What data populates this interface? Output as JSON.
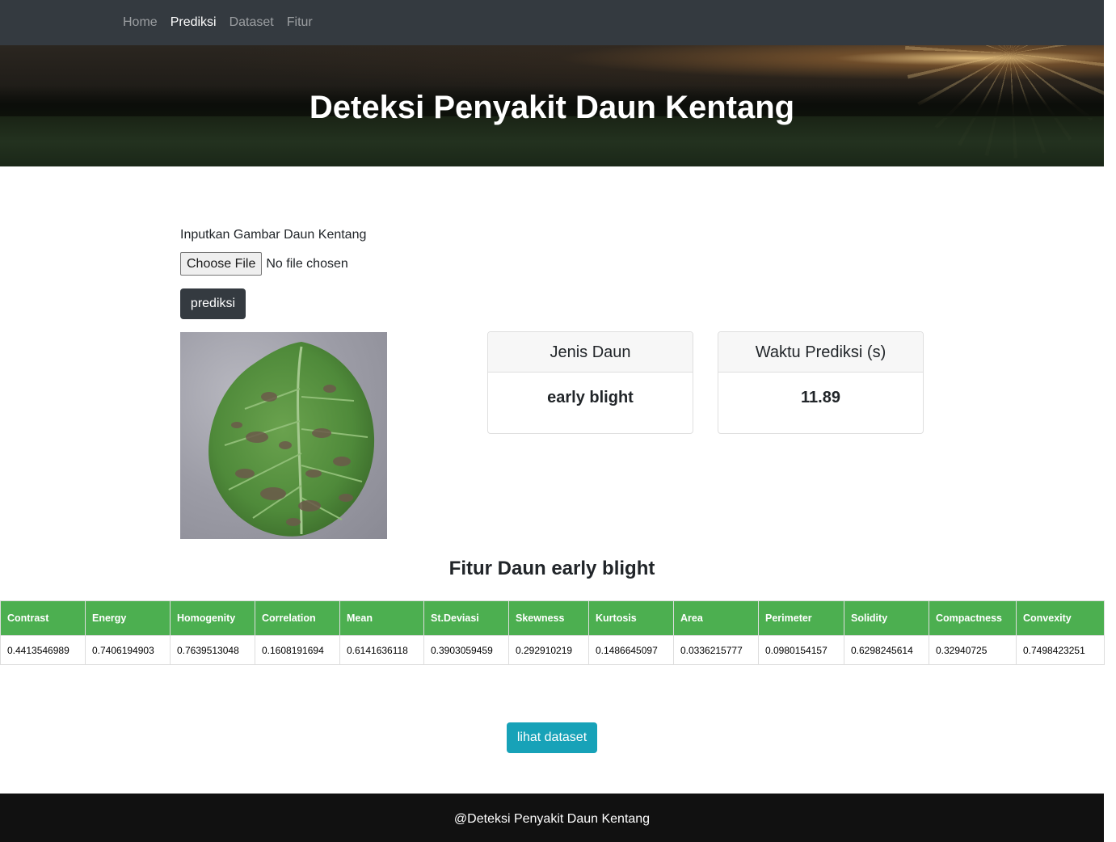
{
  "nav": {
    "items": [
      {
        "label": "Home",
        "active": false
      },
      {
        "label": "Prediksi",
        "active": true
      },
      {
        "label": "Dataset",
        "active": false
      },
      {
        "label": "Fitur",
        "active": false
      }
    ]
  },
  "hero": {
    "title": "Deteksi Penyakit Daun Kentang"
  },
  "form": {
    "label": "Inputkan Gambar Daun Kentang",
    "file_button": "Choose File",
    "file_status": "No file chosen",
    "submit_label": "prediksi"
  },
  "results": {
    "leaf_type_header": "Jenis Daun",
    "leaf_type_value": "early blight",
    "time_header": "Waktu Prediksi (s)",
    "time_value": "11.89"
  },
  "features": {
    "title": "Fitur Daun early blight",
    "columns": [
      "Contrast",
      "Energy",
      "Homogenity",
      "Correlation",
      "Mean",
      "St.Deviasi",
      "Skewness",
      "Kurtosis",
      "Area",
      "Perimeter",
      "Solidity",
      "Compactness",
      "Convexity"
    ],
    "values": [
      "0.4413546989",
      "0.7406194903",
      "0.7639513048",
      "0.1608191694",
      "0.6141636118",
      "0.3903059459",
      "0.292910219",
      "0.1486645097",
      "0.0336215777",
      "0.0980154157",
      "0.6298245614",
      "0.32940725",
      "0.7498423251"
    ]
  },
  "dataset_button": "lihat dataset",
  "footer": {
    "text": "@Deteksi Penyakit Daun Kentang"
  },
  "colors": {
    "navbar": "#343a40",
    "table_header": "#4caf50",
    "dataset_button": "#17a2b8",
    "footer": "#111111"
  }
}
